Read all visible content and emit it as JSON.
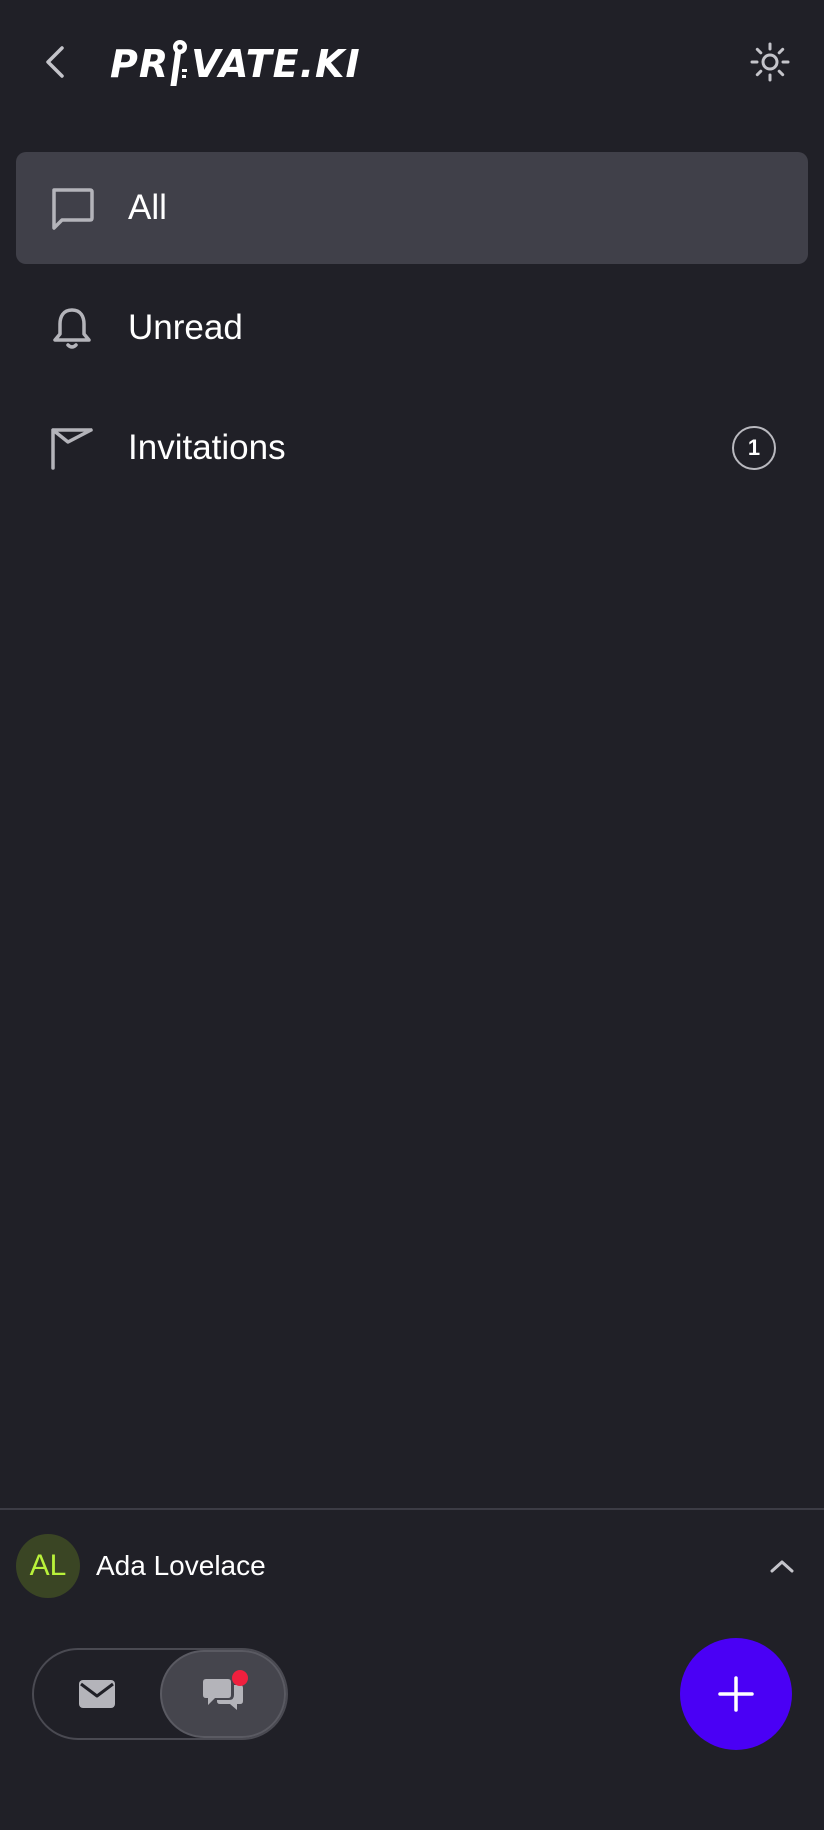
{
  "header": {
    "logo_text_left": "PR",
    "logo_text_right": "VATE.KI",
    "back_icon": "chevron-left-icon",
    "theme_icon": "sun-icon"
  },
  "nav": {
    "items": [
      {
        "label": "All",
        "icon": "chat-bubble-icon",
        "active": true
      },
      {
        "label": "Unread",
        "icon": "bell-icon",
        "active": false
      },
      {
        "label": "Invitations",
        "icon": "envelope-icon",
        "active": false,
        "badge": "1"
      }
    ]
  },
  "user": {
    "initials": "AL",
    "name": "Ada Lovelace"
  },
  "bottom": {
    "modes": [
      "mail-icon",
      "chat-icon"
    ],
    "selected_mode": "chat",
    "fab_icon": "plus-icon"
  },
  "colors": {
    "background": "#202027",
    "active_item": "#404049",
    "fab": "#4a00f5",
    "avatar_bg": "#3a4524",
    "avatar_text": "#b9f23a",
    "notification_dot": "#f0203e"
  }
}
